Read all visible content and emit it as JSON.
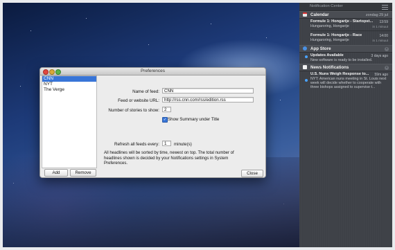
{
  "preferences": {
    "title": "Preferences",
    "feeds": [
      "CNN",
      "NYT",
      "The Verge"
    ],
    "selected_feed": "CNN",
    "add_label": "Add",
    "remove_label": "Remove",
    "name_label": "Name of feed:",
    "name_value": "CNN",
    "url_label": "Feed or website URL:",
    "url_value": "http://rss.cnn.com/rss/edition.rss",
    "stories_label": "Number of stories to show:",
    "stories_value": "2",
    "summary_label": "Show Summary under Title",
    "summary_checked": true,
    "refresh_label": "Refresh all feeds every:",
    "refresh_value": "1",
    "refresh_unit": "minute(s)",
    "info_text": "All headlines will be sorted by time, newest on top. The total number of headlines shown is decided by your Notifications settings in System Preferences.",
    "close_label": "Close"
  },
  "notification_center": {
    "header": "Notification Center",
    "calendar": {
      "title": "Calendar",
      "date": "zondag 29 jul",
      "items": [
        {
          "title": "Formule 1: Hongarije - Startopst...",
          "time": "13:59",
          "sub": "Hungaroring, Hongarije",
          "small": "in 1 minuut"
        },
        {
          "title": "Formule 1: Hongarije - Race",
          "time": "14:00",
          "sub": "Hungaroring, Hongarije",
          "small": "in 1 minuut"
        }
      ]
    },
    "app_store": {
      "title": "App Store",
      "close": "×",
      "item": {
        "title": "Updates Available",
        "time": "3 days ago",
        "body": "New software is ready to be installed."
      }
    },
    "news": {
      "title": "News Notifications",
      "close": "×",
      "item": {
        "title": "U.S. Nuns Weigh Response to...",
        "time": "59m ago",
        "body": "NYT: American nuns meeting in St. Louis next week will decide whether to cooperate with three bishops assigned to supervise t..."
      }
    }
  },
  "colors": {
    "accent": "#3875d7",
    "nc_background": "#3e4147",
    "unread_dot": "#4aa3ff"
  }
}
